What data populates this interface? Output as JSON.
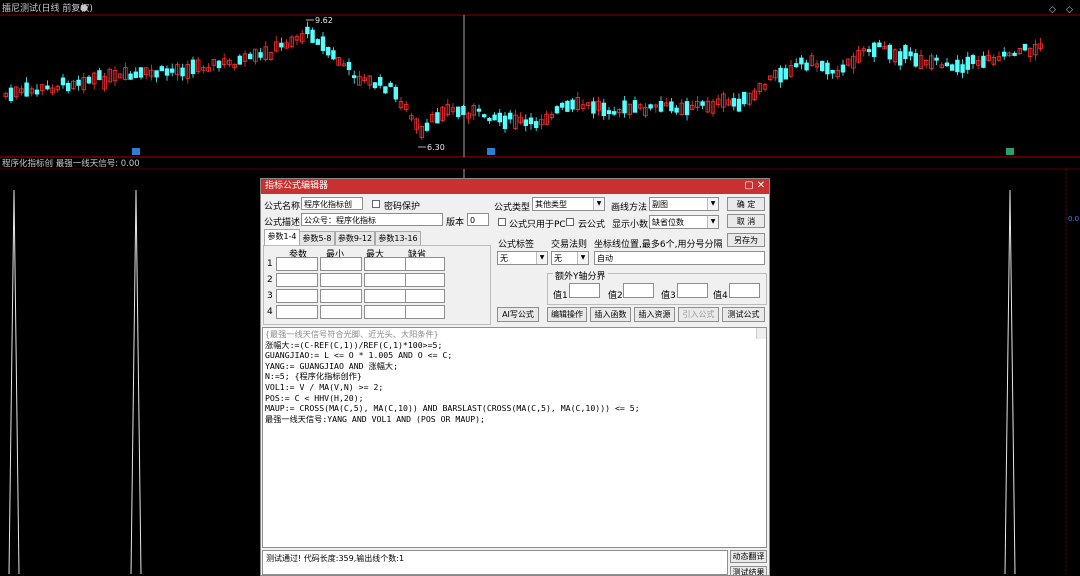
{
  "window_title": "擂尼测试(日线 前复权)",
  "price_labels": {
    "high": "9.62",
    "low": "6.30"
  },
  "subchart_title": "程序化指标创  最强一线天信号: 0.00",
  "right_axis_label": "0.0",
  "colors": {
    "up": "#ff3232",
    "down": "#54ffff",
    "bg": "#000000",
    "grid": "#b00000",
    "dialog_title": "#c8312f"
  },
  "dialog": {
    "title": "指标公式编辑器",
    "controls": {
      "minimize": "▢",
      "close": "✕"
    },
    "labels": {
      "formula_name": "公式名称",
      "password_protect": "密码保护",
      "formula_desc": "公式描述",
      "version": "版本",
      "formula_type": "公式类型",
      "draw_method": "画线方法",
      "pc_only": "公式只用于PC",
      "cloud": "云公式",
      "decimals": "显示小数",
      "formula_tag": "公式标签",
      "trade_rule": "交易法则",
      "axis_pos": "坐标线位置,最多6个,用分号分隔",
      "extra_y": "额外Y轴分界",
      "val1": "值1",
      "val2": "值2",
      "val3": "值3",
      "val4": "值4"
    },
    "values": {
      "formula_name": "程序化指标创",
      "formula_desc": "公众号：程序化指标",
      "version": "0",
      "formula_type": "其他类型",
      "draw_method": "副图",
      "decimals": "缺省位数",
      "formula_tag": "无",
      "trade_rule": "无",
      "axis_pos": "自动"
    },
    "buttons": {
      "ok": "确  定",
      "cancel": "取  消",
      "save_as": "另存为",
      "ai": "AI写公式",
      "edit_op": "编辑操作",
      "insert_func": "插入函数",
      "insert_res": "插入资源",
      "import": "引入公式",
      "test": "测试公式",
      "dyn_translate": "动态翻译",
      "test_result": "测试结果"
    },
    "tabs": [
      "参数1-4",
      "参数5-8",
      "参数9-12",
      "参数13-16"
    ],
    "param_headers": [
      "参数",
      "最小",
      "最大",
      "缺省"
    ],
    "param_rows": [
      "1",
      "2",
      "3",
      "4"
    ],
    "code_lines": [
      {
        "t": "{最强一线天信号符合光脚、近光头、大阳条件}",
        "cls": "c-cm"
      },
      {
        "t": "涨幅大:=(C-REF(C,1))/REF(C,1)*100>=5;",
        "cls": ""
      },
      {
        "t": "GUANGJIAO:= L <= O * 1.005 AND O <= C;",
        "cls": ""
      },
      {
        "t": "YANG:= GUANGJIAO AND 涨幅大;",
        "cls": ""
      },
      {
        "t": "N:=5; {程序化指标创作}",
        "cls": ""
      },
      {
        "t": "VOL1:= V / MA(V,N) >= 2;",
        "cls": ""
      },
      {
        "t": "POS:= C < HHV(H,20);",
        "cls": ""
      },
      {
        "t": "MAUP:= CROSS(MA(C,5), MA(C,10)) AND BARSLAST(CROSS(MA(C,5), MA(C,10))) <= 5;",
        "cls": ""
      },
      {
        "t": "最强一线天信号:YANG AND VOL1 AND (POS OR MAUP);",
        "cls": ""
      }
    ],
    "status": "测试通过! 代码长度:359,输出线个数:1"
  }
}
